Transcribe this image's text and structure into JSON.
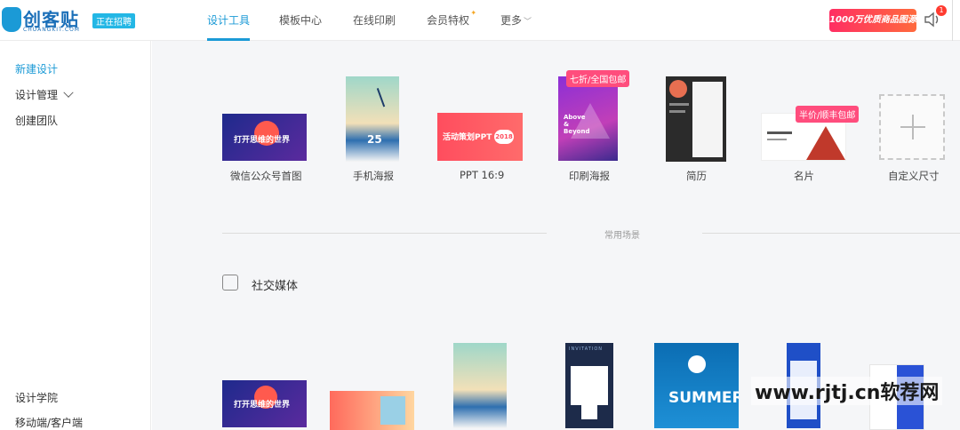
{
  "brand": {
    "name": "创客贴",
    "sub": "CHUANGKIT.COM",
    "hiring": "正在招聘"
  },
  "nav": [
    "设计工具",
    "模板中心",
    "在线印刷",
    "会员特权",
    "更多"
  ],
  "promo": "1000万优质商品图源",
  "notification_count": "1",
  "sidebar": {
    "top": [
      "新建设计",
      "设计管理",
      "创建团队"
    ],
    "bottom": [
      "设计学院",
      "移动端/客户端"
    ]
  },
  "design_types": [
    {
      "label": "微信公众号首图",
      "thumb_text": "打开思维的世界"
    },
    {
      "label": "手机海报",
      "thumb_text": "25"
    },
    {
      "label": "PPT 16:9",
      "thumb_text": "活动策划PPT",
      "thumb_year": "2018"
    },
    {
      "label": "印刷海报",
      "tag": "七折/全国包邮",
      "thumb_text": "Above & Beyond"
    },
    {
      "label": "简历"
    },
    {
      "label": "名片",
      "tag": "半价/顺丰包邮"
    },
    {
      "label": "自定义尺寸"
    }
  ],
  "divider_label": "常用场景",
  "section_title": "社交媒体",
  "social_thumbs": {
    "wechat": "打开思维的世界",
    "summer": "SUMMER",
    "invitation": "INVITATION"
  },
  "watermark": "www.rjtj.cn软荐网",
  "colors": {
    "accent": "#1b9ad6",
    "tag": "#ff4d7d"
  }
}
